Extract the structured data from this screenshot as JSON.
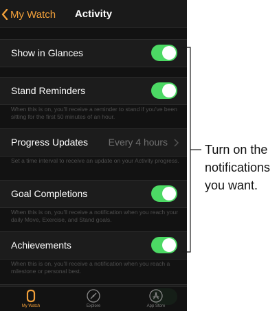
{
  "nav": {
    "back_label": "My Watch",
    "title": "Activity"
  },
  "settings": {
    "show_in_glances": {
      "label": "Show in Glances",
      "enabled": true
    },
    "stand_reminders": {
      "label": "Stand Reminders",
      "enabled": true,
      "description": "When this is on, you'll receive a reminder to stand if you've been sitting for the first 50 minutes of an hour."
    },
    "progress_updates": {
      "label": "Progress Updates",
      "value": "Every 4 hours",
      "description": "Set a time interval to receive an update on your Activity progress."
    },
    "goal_completions": {
      "label": "Goal Completions",
      "enabled": true,
      "description": "When this is on, you'll receive a notification when you reach your daily Move, Exercise, and Stand goals."
    },
    "achievements": {
      "label": "Achievements",
      "enabled": true,
      "description": "When this is on, you'll receive a notification when you reach a milestone or personal best."
    }
  },
  "tabbar": {
    "tabs": [
      {
        "label": "My Watch",
        "icon": "watch-icon",
        "selected": true
      },
      {
        "label": "Explore",
        "icon": "compass-icon",
        "selected": false
      },
      {
        "label": "App Store",
        "icon": "app-store-icon",
        "selected": false
      }
    ]
  },
  "annotation": {
    "text": "Turn on the notifications you want."
  },
  "colors": {
    "accent": "#f2a03a",
    "toggle_on": "#4cd964",
    "background": "#121212"
  }
}
